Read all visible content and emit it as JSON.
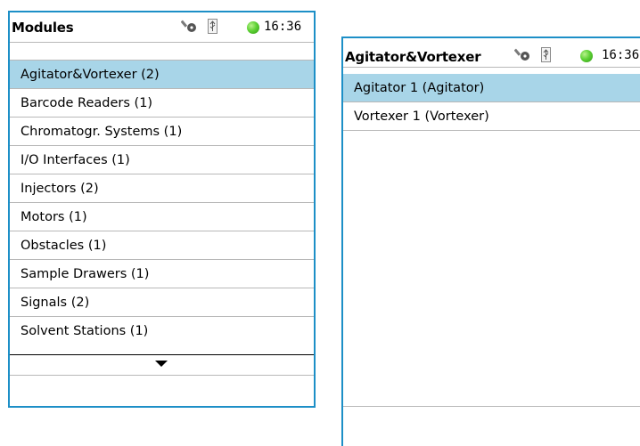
{
  "modules_panel": {
    "title": "Modules",
    "time": "16:36",
    "items": [
      "Agitator&Vortexer (2)",
      "Barcode Readers (1)",
      "Chromatogr. Systems (1)",
      "I/O Interfaces (1)",
      "Injectors (2)",
      "Motors (1)",
      "Obstacles (1)",
      "Sample Drawers (1)",
      "Signals (2)",
      "Solvent Stations (1)"
    ],
    "selected_item": "Agitator&Vortexer (2)",
    "icons": [
      "key-icon",
      "usb-icon",
      "status-green-icon",
      "scroll-down-arrow-icon"
    ]
  },
  "detail_panel": {
    "title": "Agitator&Vortexer",
    "time": "16:36",
    "items": [
      "Agitator 1 (Agitator)",
      "Vortexer 1 (Vortexer)"
    ],
    "selected_item": "Agitator 1 (Agitator)",
    "icons": [
      "key-icon",
      "usb-icon",
      "status-green-icon"
    ]
  },
  "colors": {
    "frame": "#1d8fc7",
    "selection": "#a8d5e8",
    "status_ok": "#5fd236",
    "divider": "#b8b8b8"
  }
}
